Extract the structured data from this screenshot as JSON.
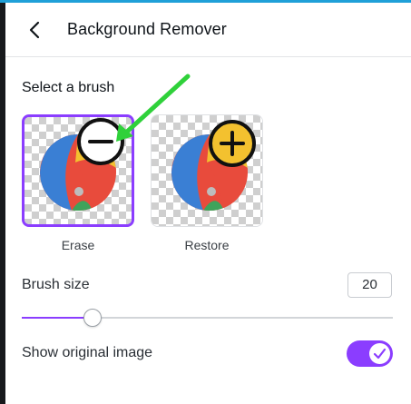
{
  "header": {
    "title": "Background Remover",
    "back_icon": "chevron-left-icon"
  },
  "brush": {
    "section_title": "Select a brush",
    "options": [
      {
        "label": "Erase",
        "icon": "minus-circle-icon",
        "selected": true
      },
      {
        "label": "Restore",
        "icon": "plus-circle-icon",
        "selected": false
      }
    ]
  },
  "brush_size": {
    "label": "Brush size",
    "value": "20",
    "slider_fraction": 0.19
  },
  "show_original": {
    "label": "Show original image",
    "enabled": true
  },
  "colors": {
    "accent": "#8b3dff",
    "annotation_arrow": "#2fd13a"
  }
}
